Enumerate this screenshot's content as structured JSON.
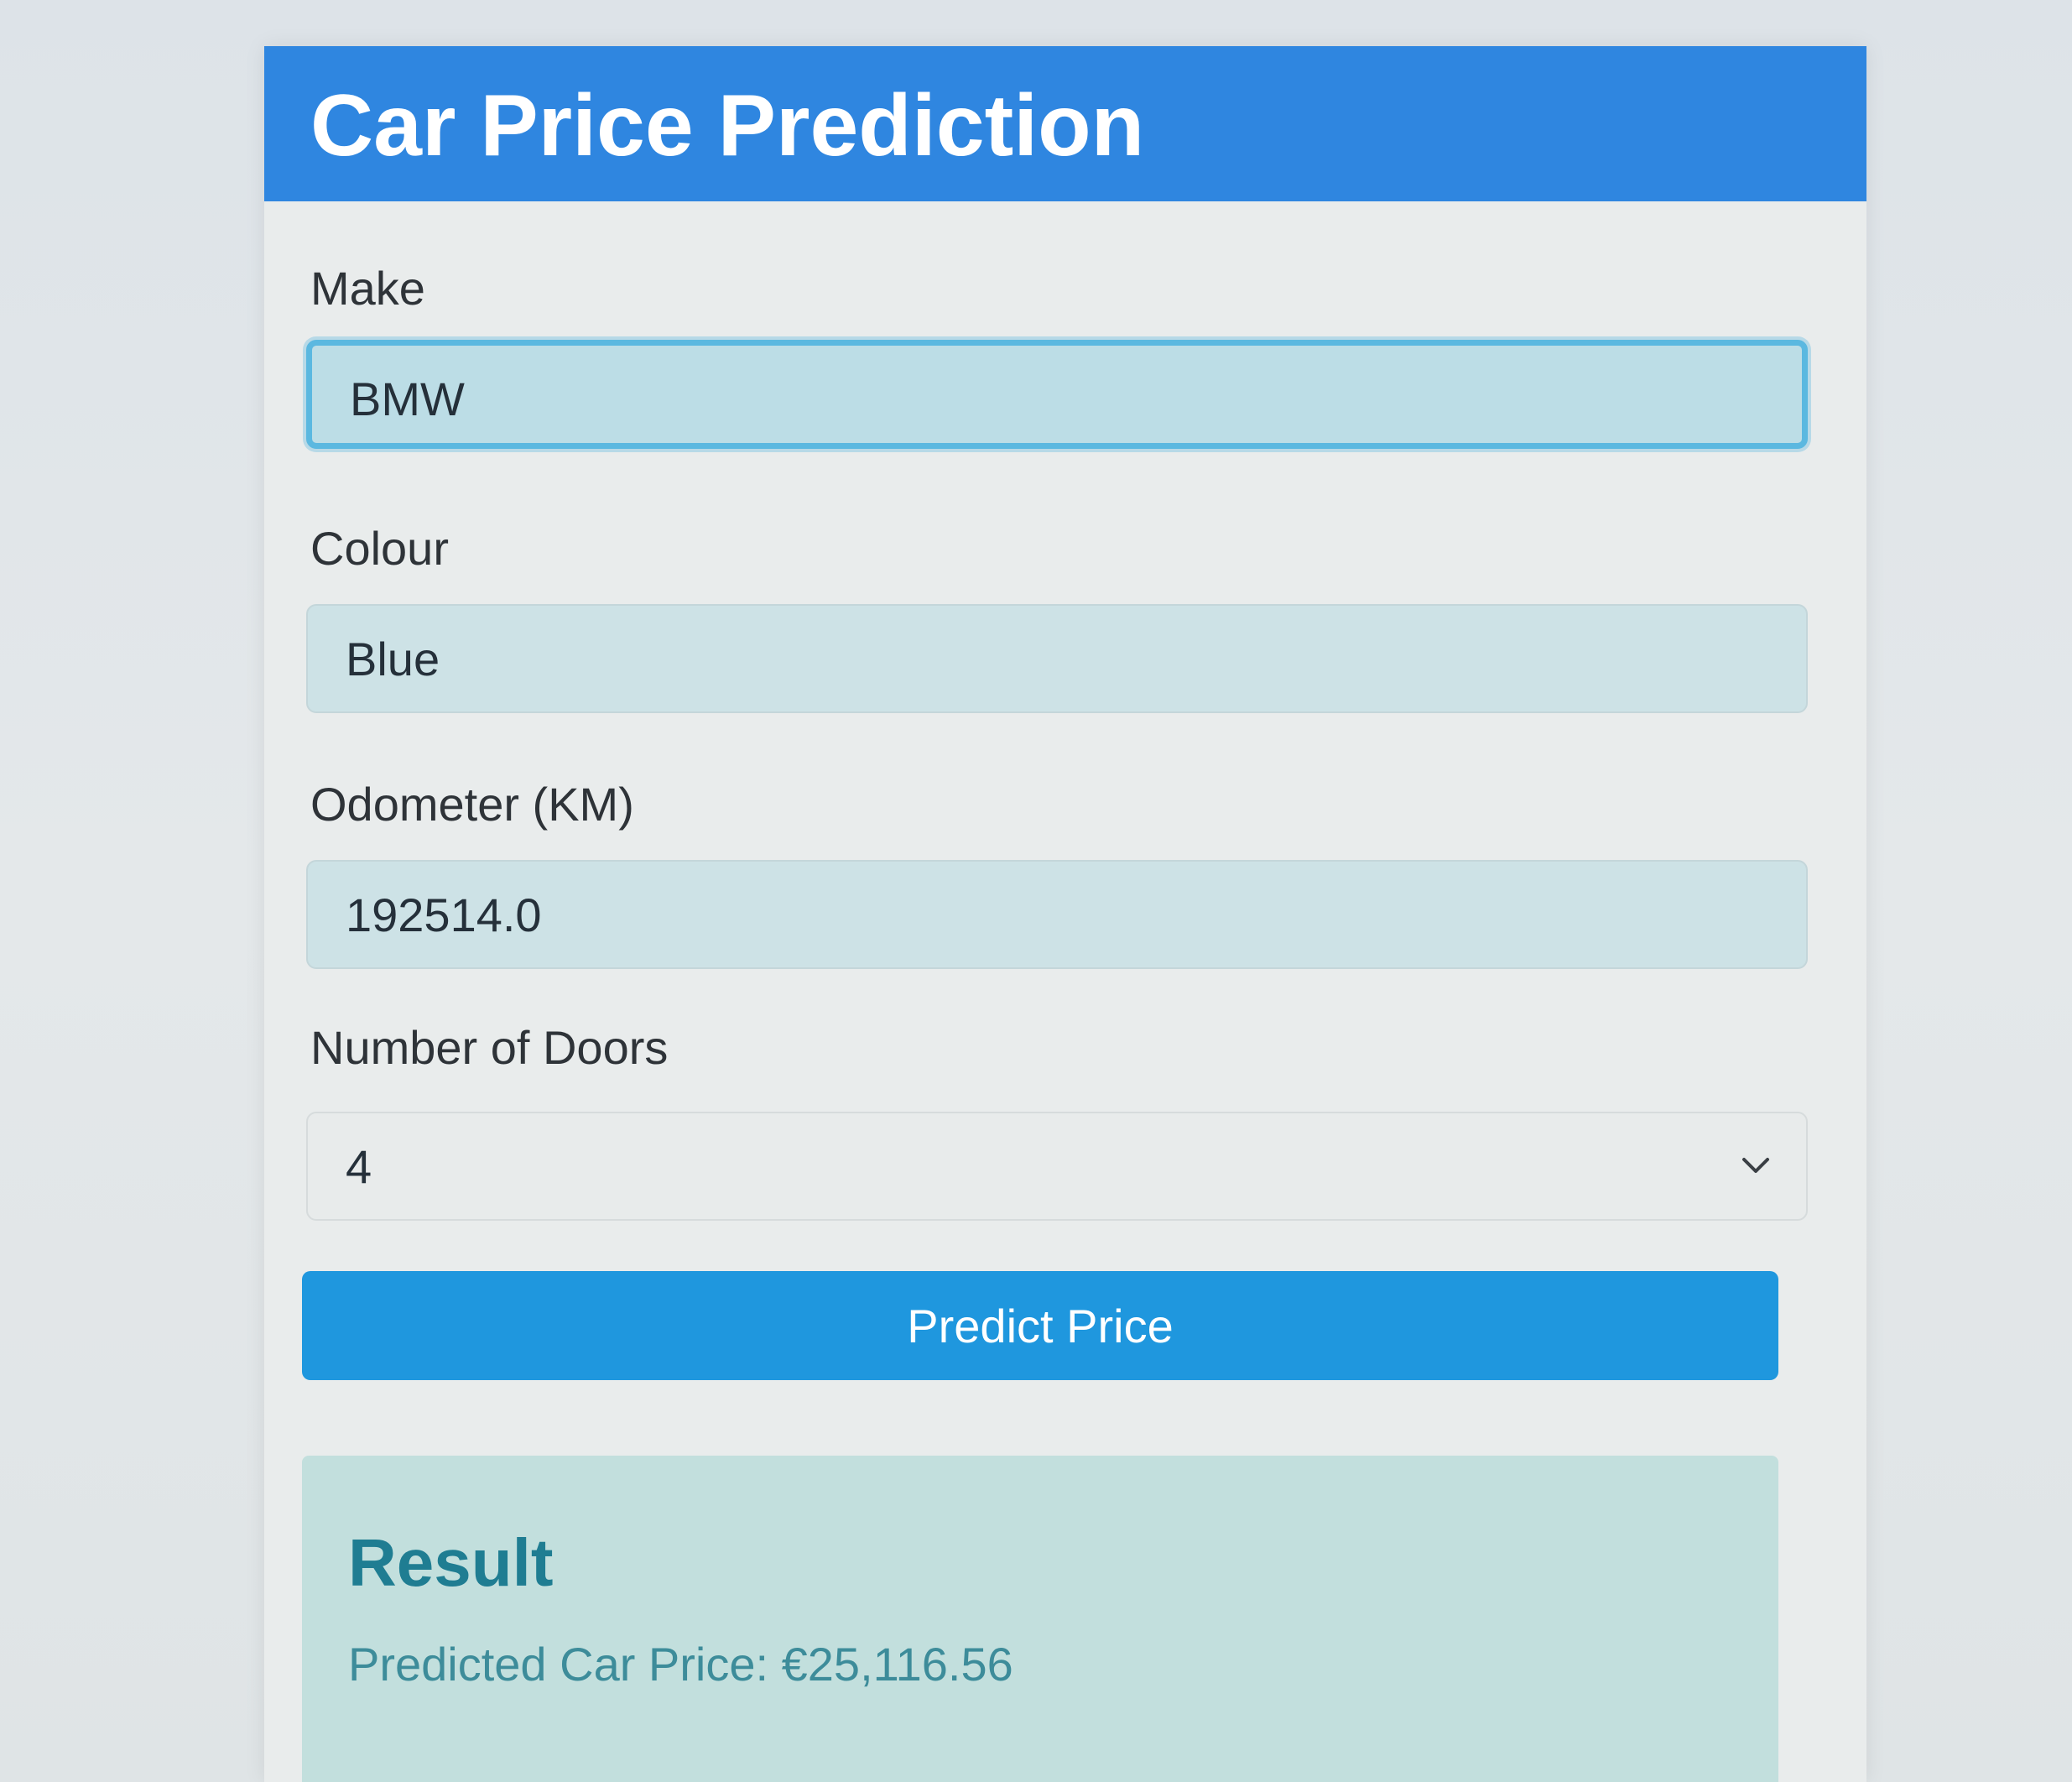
{
  "header": {
    "title": "Car Price Prediction"
  },
  "form": {
    "make": {
      "label": "Make",
      "value": "BMW"
    },
    "colour": {
      "label": "Colour",
      "value": "Blue"
    },
    "odometer": {
      "label": "Odometer (KM)",
      "value": "192514.0"
    },
    "doors": {
      "label": "Number of Doors",
      "value": "4",
      "icon": "chevron-down-icon"
    }
  },
  "actions": {
    "predict_label": "Predict Price"
  },
  "result": {
    "heading": "Result",
    "text": "Predicted Car Price: €25,116.56"
  },
  "colors": {
    "header_bg": "#2f86e0",
    "button_bg": "#1f97de",
    "result_bg": "#c2dfdd",
    "result_heading": "#1f7d92",
    "focus_ring": "#5bb8e0"
  }
}
